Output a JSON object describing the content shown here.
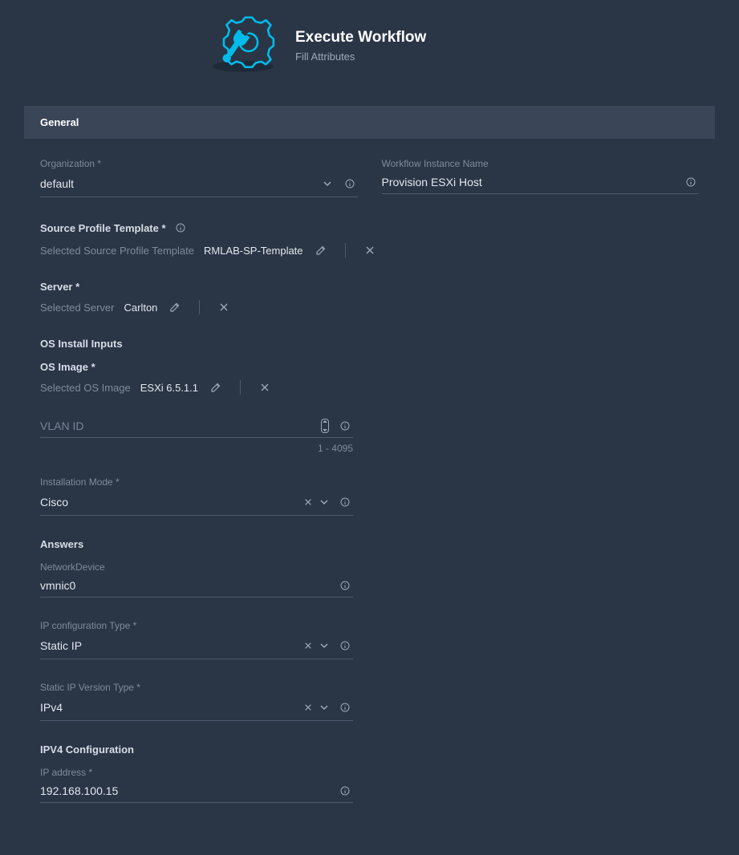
{
  "header": {
    "title": "Execute Workflow",
    "subtitle": "Fill Attributes"
  },
  "section": "General",
  "fields": {
    "org_label": "Organization *",
    "org_value": "default",
    "wf_name_label": "Workflow Instance Name",
    "wf_name_value": "Provision ESXi Host",
    "spt_head": "Source Profile Template *",
    "spt_sel_label": "Selected Source Profile Template",
    "spt_sel_value": "RMLAB-SP-Template",
    "server_head": "Server *",
    "server_sel_label": "Selected Server",
    "server_sel_value": "Carlton",
    "os_inputs_head": "OS Install Inputs",
    "os_image_head": "OS Image *",
    "os_image_sel_label": "Selected OS Image",
    "os_image_sel_value": "ESXi 6.5.1.1",
    "vlan_placeholder": "VLAN ID",
    "vlan_hint": "1 - 4095",
    "install_mode_label": "Installation Mode *",
    "install_mode_value": "Cisco",
    "answers_head": "Answers",
    "netdev_label": "NetworkDevice",
    "netdev_value": "vmnic0",
    "ipcfg_label": "IP configuration Type *",
    "ipcfg_value": "Static IP",
    "ipver_label": "Static IP Version Type *",
    "ipver_value": "IPv4",
    "ipv4_head": "IPV4 Configuration",
    "ipaddr_label": "IP address *",
    "ipaddr_value": "192.168.100.15"
  }
}
